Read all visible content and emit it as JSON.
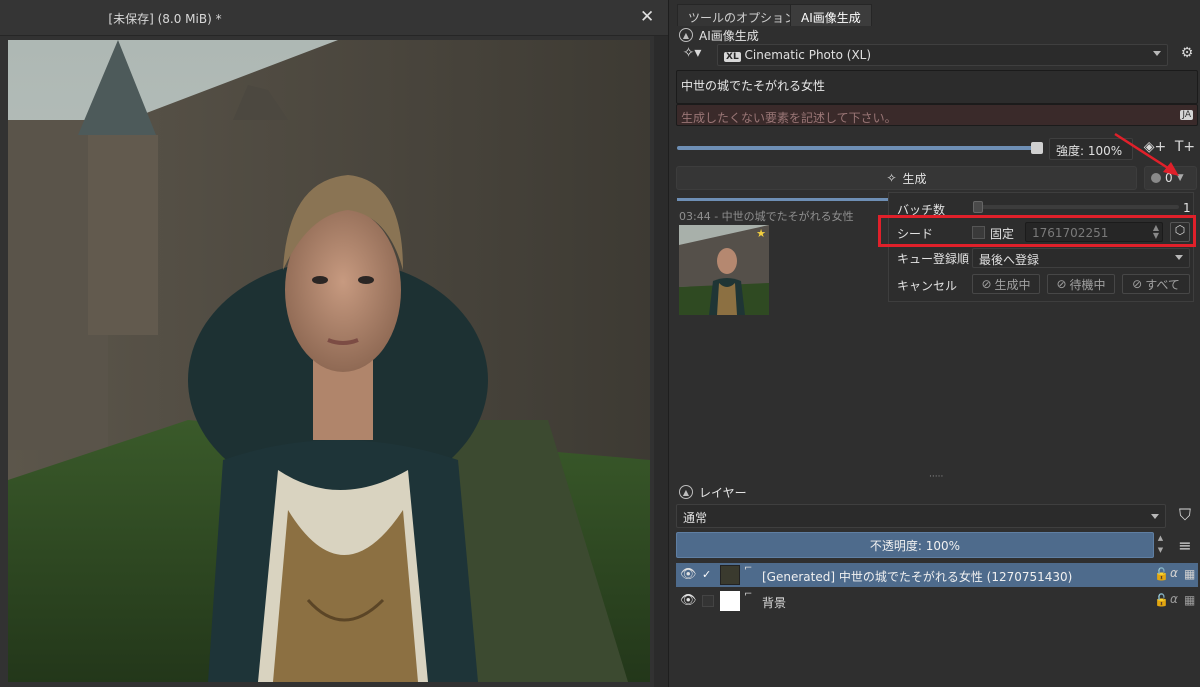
{
  "document": {
    "title": "[未保存]  (8.0 MiB) *",
    "close_icon": "close-icon"
  },
  "tabs": [
    {
      "label": "ツールのオプション"
    },
    {
      "label": "AI画像生成"
    }
  ],
  "ai_panel": {
    "title": "AI画像生成",
    "style_tag": "XL",
    "style_value": "Cinematic Photo (XL)",
    "prompt": "中世の城でたそがれる女性",
    "negative_placeholder": "生成したくない要素を記述して下さい。",
    "language_badge": "JA",
    "strength_label": "強度: 100%",
    "strength_fraction": 1.0,
    "generate_label": "生成",
    "queue_count": "0",
    "history_label": "03:44 - 中世の城でたそがれる女性",
    "popup": {
      "batch_label": "バッチ数",
      "batch_value": "1",
      "seed_label": "シード",
      "fixed_label": "固定",
      "seed_value": "1761702251",
      "queue_label": "キュー登録順",
      "queue_value": "最後へ登録",
      "cancel_label": "キャンセル",
      "cancel_generating": "生成中",
      "cancel_waiting": "待機中",
      "cancel_all": "すべて"
    }
  },
  "layers_panel": {
    "title": "レイヤー",
    "blend_mode": "通常",
    "opacity_label": "不透明度: 100%",
    "layers": [
      {
        "name": "[Generated] 中世の城でたそがれる女性 (1270751430)",
        "selected": true,
        "checked": true
      },
      {
        "name": "背景",
        "selected": false,
        "checked": false
      }
    ]
  },
  "colors": {
    "accent": "#4e6b8c",
    "highlight_box": "#e0202a",
    "arrow": "#e0202a",
    "negative_bg": "#3a2a2a"
  }
}
